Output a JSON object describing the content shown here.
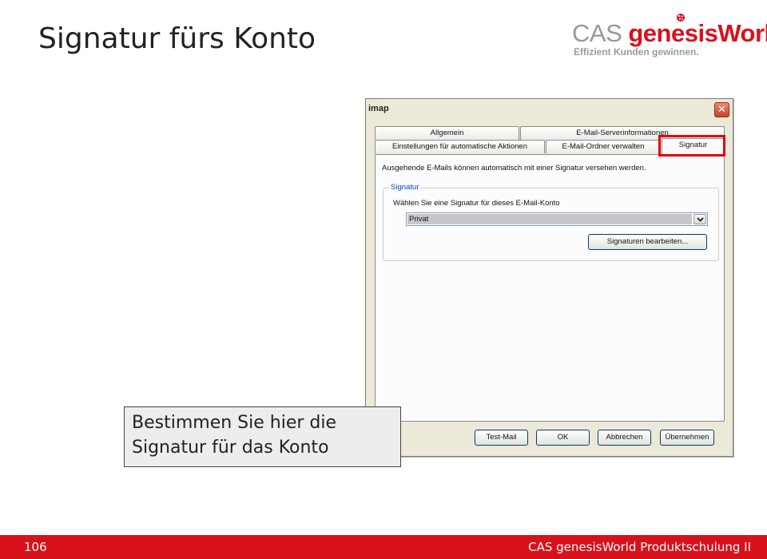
{
  "slide": {
    "title": "Signatur fürs Konto"
  },
  "logo": {
    "brand_prefix": "CAS",
    "brand_name": "genesisWorld",
    "tagline": "Effizient Kunden gewinnen.",
    "colors": {
      "gray": "#999999",
      "red": "#d9111b"
    }
  },
  "dialog": {
    "title": "imap",
    "close_icon": "close-icon",
    "tabs_row_back": [
      "Allgemein",
      "E-Mail-Serverinformationen"
    ],
    "tabs_row_front": [
      "Einstellungen für automatische Aktionen",
      "E-Mail-Ordner verwalten",
      "Signatur"
    ],
    "active_tab": "Signatur",
    "info_text": "Ausgehende E-Mails können automatisch mit einer Signatur versehen werden.",
    "group": {
      "legend": "Signatur",
      "label": "Wählen Sie eine Signatur für dieses E-Mail-Konto",
      "selected_value": "Privat",
      "edit_button": "Signaturen bearbeiten..."
    },
    "buttons": {
      "test_mail": "Test-Mail",
      "ok": "OK",
      "cancel": "Abbrechen",
      "apply": "Übernehmen"
    },
    "highlight_color": "#e0000b"
  },
  "callout": {
    "line1": "Bestimmen Sie hier die",
    "line2": "Signatur für das Konto"
  },
  "footer": {
    "page_number": "106",
    "course": "CAS genesisWorld Produktschulung II",
    "color": "#d9111b"
  }
}
